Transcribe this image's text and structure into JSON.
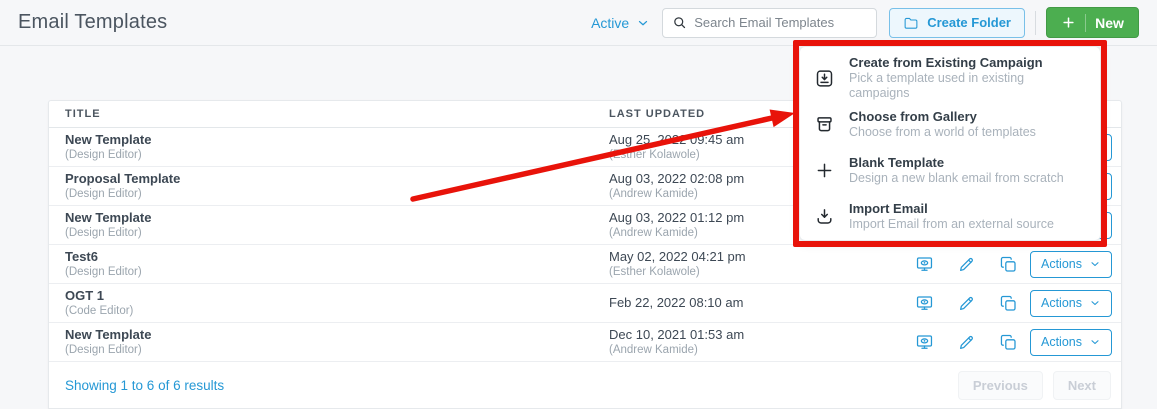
{
  "page": {
    "title": "Email Templates",
    "filter_label": "Active",
    "search_placeholder": "Search Email Templates",
    "create_folder_label": "Create Folder",
    "new_label": "New"
  },
  "dropdown_menu": {
    "items": [
      {
        "icon": "save-tray-icon",
        "title": "Create from Existing Campaign",
        "description": "Pick a template used in existing campaigns"
      },
      {
        "icon": "archive-box-icon",
        "title": "Choose from Gallery",
        "description": "Choose from a world of templates"
      },
      {
        "icon": "plus-icon",
        "title": "Blank Template",
        "description": "Design a new blank email from scratch"
      },
      {
        "icon": "download-icon",
        "title": "Import Email",
        "description": "Import Email from an external source"
      }
    ]
  },
  "table": {
    "columns": [
      "TITLE",
      "LAST UPDATED"
    ],
    "row_action_icons": [
      "preview",
      "edit",
      "duplicate"
    ],
    "actions_label": "Actions",
    "rows": [
      {
        "title": "New Template",
        "subtitle": "(Design Editor)",
        "updated": "Aug 25, 2022 09:45 am",
        "updated_by": "(Esther Kolawole)"
      },
      {
        "title": "Proposal Template",
        "subtitle": "(Design Editor)",
        "updated": "Aug 03, 2022 02:08 pm",
        "updated_by": "(Andrew Kamide)"
      },
      {
        "title": "New Template",
        "subtitle": "(Design Editor)",
        "updated": "Aug 03, 2022 01:12 pm",
        "updated_by": "(Andrew Kamide)"
      },
      {
        "title": "Test6",
        "subtitle": "(Design Editor)",
        "updated": "May 02, 2022 04:21 pm",
        "updated_by": "(Esther Kolawole)"
      },
      {
        "title": "OGT 1",
        "subtitle": "(Code Editor)",
        "updated": "Feb 22, 2022 08:10 am",
        "updated_by": ""
      },
      {
        "title": "New Template",
        "subtitle": "(Design Editor)",
        "updated": "Dec 10, 2021 01:53 am",
        "updated_by": "(Andrew Kamide)"
      }
    ],
    "footer": {
      "summary": "Showing 1 to 6 of 6 results",
      "previous_label": "Previous",
      "next_label": "Next"
    }
  },
  "colors": {
    "accent_blue": "#2598d5",
    "new_button_green": "#4cae50",
    "annotation_red": "#e8130a"
  }
}
